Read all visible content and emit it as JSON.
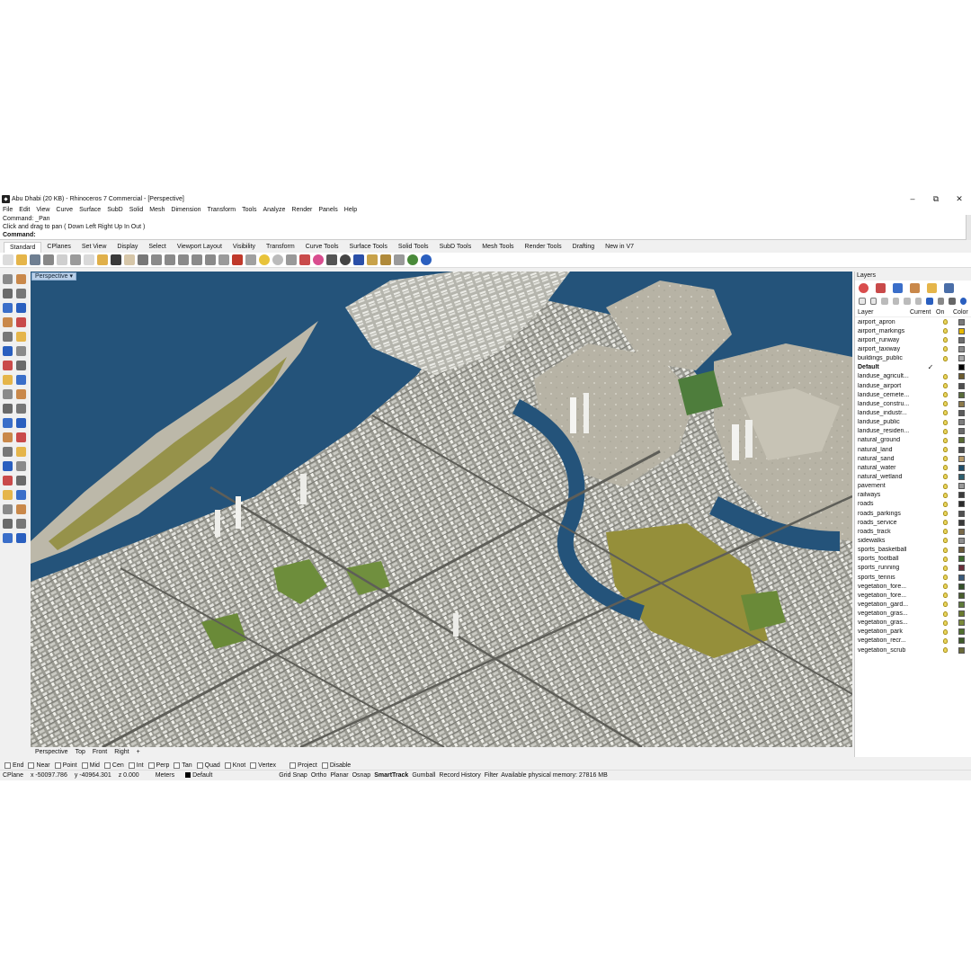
{
  "window": {
    "title": "Abu Dhabi (20 KB) - Rhinoceros 7 Commercial - [Perspective]",
    "minimize": "–",
    "maximize": "⧉",
    "close": "✕"
  },
  "menu": [
    "File",
    "Edit",
    "View",
    "Curve",
    "Surface",
    "SubD",
    "Solid",
    "Mesh",
    "Dimension",
    "Transform",
    "Tools",
    "Analyze",
    "Render",
    "Panels",
    "Help"
  ],
  "command": {
    "history_1": "Command: _Pan",
    "history_2": "Click and drag to pan ( Down  Left  Right  Up  In  Out )",
    "prompt": "Command:"
  },
  "toolbar_tabs": [
    "Standard",
    "CPlanes",
    "Set View",
    "Display",
    "Select",
    "Viewport Layout",
    "Visibility",
    "Transform",
    "Curve Tools",
    "Surface Tools",
    "Solid Tools",
    "SubD Tools",
    "Mesh Tools",
    "Render Tools",
    "Drafting",
    "New in V7"
  ],
  "toolbar_icons": [
    {
      "name": "new-icon",
      "color": "#dcdcdc"
    },
    {
      "name": "open-icon",
      "color": "#e5b54a"
    },
    {
      "name": "save-icon",
      "color": "#6f7f92"
    },
    {
      "name": "print-icon",
      "color": "#888888"
    },
    {
      "name": "export-icon",
      "color": "#cfcfcf"
    },
    {
      "name": "cut-icon",
      "color": "#9a9a9a"
    },
    {
      "name": "copy-icon",
      "color": "#d9d9d9"
    },
    {
      "name": "paste-icon",
      "color": "#e0b04a"
    },
    {
      "name": "undo-icon",
      "color": "#3a3a3a"
    },
    {
      "name": "pan-icon",
      "color": "#d6c6a8"
    },
    {
      "name": "rotate-icon",
      "color": "#777777"
    },
    {
      "name": "zoom-icon",
      "color": "#8a8a8a"
    },
    {
      "name": "zoom-window-icon",
      "color": "#8a8a8a"
    },
    {
      "name": "zoom-extents-icon",
      "color": "#8a8a8a"
    },
    {
      "name": "zoom-selected-icon",
      "color": "#8a8a8a"
    },
    {
      "name": "undo-view-icon",
      "color": "#8a8a8a"
    },
    {
      "name": "four-viewports-icon",
      "color": "#9a9a9a"
    },
    {
      "name": "car-icon",
      "color": "#c0392b"
    },
    {
      "name": "select-icon",
      "color": "#a0a0a0"
    },
    {
      "name": "sun-icon",
      "color": "#e8c33a"
    },
    {
      "name": "light-icon",
      "color": "#bbbbbb"
    },
    {
      "name": "lock-icon",
      "color": "#999999"
    },
    {
      "name": "layer-icon",
      "color": "#c94a4a"
    },
    {
      "name": "color-wheel-icon",
      "color": "#d94d8f"
    },
    {
      "name": "material-icon",
      "color": "#555555"
    },
    {
      "name": "render-sphere-icon",
      "color": "#444444"
    },
    {
      "name": "render-icon",
      "color": "#2a4fa8"
    },
    {
      "name": "shade-icon",
      "color": "#c8a24a"
    },
    {
      "name": "gear-icon",
      "color": "#b08a3a"
    },
    {
      "name": "grid-icon",
      "color": "#9a9a9a"
    },
    {
      "name": "globe-icon",
      "color": "#4a8a3a"
    },
    {
      "name": "help-icon",
      "color": "#2a5fbf"
    }
  ],
  "viewport": {
    "label": "Perspective",
    "tabs": [
      "Perspective",
      "Top",
      "Front",
      "Right"
    ],
    "add_tab": "+"
  },
  "osnap": [
    "End",
    "Near",
    "Point",
    "Mid",
    "Cen",
    "Int",
    "Perp",
    "Tan",
    "Quad",
    "Knot",
    "Vertex",
    "Project",
    "Disable"
  ],
  "status": {
    "cplane": "CPlane",
    "x": "x -50097.786",
    "y": "y -40964.301",
    "z": "z 0.000",
    "units": "Meters",
    "layer": "Default",
    "grid_snap": "Grid Snap",
    "ortho": "Ortho",
    "planar": "Planar",
    "osnap": "Osnap",
    "smarttrack": "SmartTrack",
    "gumball": "Gumball",
    "record_history": "Record History",
    "filter": "Filter",
    "memory": "Available physical memory: 27816 MB"
  },
  "layers_panel": {
    "title": "Layers",
    "header": {
      "layer": "Layer",
      "current": "Current",
      "on": "On",
      "color": "Color"
    },
    "current_mark": "✓",
    "layers": [
      {
        "name": "airport_apron",
        "color": "#7a7a7a",
        "current": false
      },
      {
        "name": "airport_markings",
        "color": "#e6b800",
        "current": false
      },
      {
        "name": "airport_runway",
        "color": "#6e6e6e",
        "current": false
      },
      {
        "name": "airport_taxiway",
        "color": "#8a8a8a",
        "current": false
      },
      {
        "name": "buildings_public",
        "color": "#a9a9a9",
        "current": false
      },
      {
        "name": "Default",
        "color": "#000000",
        "current": true
      },
      {
        "name": "landuse_agricult...",
        "color": "#6b5b2e",
        "current": false
      },
      {
        "name": "landuse_airport",
        "color": "#4f4f4f",
        "current": false
      },
      {
        "name": "landuse_cemete...",
        "color": "#596b3a",
        "current": false
      },
      {
        "name": "landuse_constru...",
        "color": "#8c7a4a",
        "current": false
      },
      {
        "name": "landuse_industr...",
        "color": "#5c5c5c",
        "current": false
      },
      {
        "name": "landuse_public",
        "color": "#7d7d7d",
        "current": false
      },
      {
        "name": "landuse_residen...",
        "color": "#6a6a6a",
        "current": false
      },
      {
        "name": "natural_ground",
        "color": "#5a6b34",
        "current": false
      },
      {
        "name": "natural_land",
        "color": "#4d4d4d",
        "current": false
      },
      {
        "name": "natural_sand",
        "color": "#b59a6a",
        "current": false
      },
      {
        "name": "natural_water",
        "color": "#1f4e6b",
        "current": false
      },
      {
        "name": "natural_wetland",
        "color": "#2e5f6e",
        "current": false
      },
      {
        "name": "pavement",
        "color": "#9a9a9a",
        "current": false
      },
      {
        "name": "railways",
        "color": "#3c3c3c",
        "current": false
      },
      {
        "name": "roads",
        "color": "#2b2b2b",
        "current": false
      },
      {
        "name": "roads_parkings",
        "color": "#505050",
        "current": false
      },
      {
        "name": "roads_service",
        "color": "#3a3a3a",
        "current": false
      },
      {
        "name": "roads_track",
        "color": "#7a6a4a",
        "current": false
      },
      {
        "name": "sidewalks",
        "color": "#8f8f8f",
        "current": false
      },
      {
        "name": "sports_basketball",
        "color": "#6a5a3a",
        "current": false
      },
      {
        "name": "sports_football",
        "color": "#3f6a2e",
        "current": false
      },
      {
        "name": "sports_running",
        "color": "#6b2e3a",
        "current": false
      },
      {
        "name": "sports_tennis",
        "color": "#3a5a7a",
        "current": false
      },
      {
        "name": "vegetation_fore...",
        "color": "#35502a",
        "current": false
      },
      {
        "name": "vegetation_fore...",
        "color": "#4a5f2e",
        "current": false
      },
      {
        "name": "vegetation_gard...",
        "color": "#5f7a3a",
        "current": false
      },
      {
        "name": "vegetation_gras...",
        "color": "#6a7a2e",
        "current": false
      },
      {
        "name": "vegetation_gras...",
        "color": "#7a8a3a",
        "current": false
      },
      {
        "name": "vegetation_park",
        "color": "#4f6e2e",
        "current": false
      },
      {
        "name": "vegetation_recr...",
        "color": "#3e5a2a",
        "current": false
      },
      {
        "name": "vegetation_scrub",
        "color": "#6a6a3a",
        "current": false
      }
    ]
  }
}
